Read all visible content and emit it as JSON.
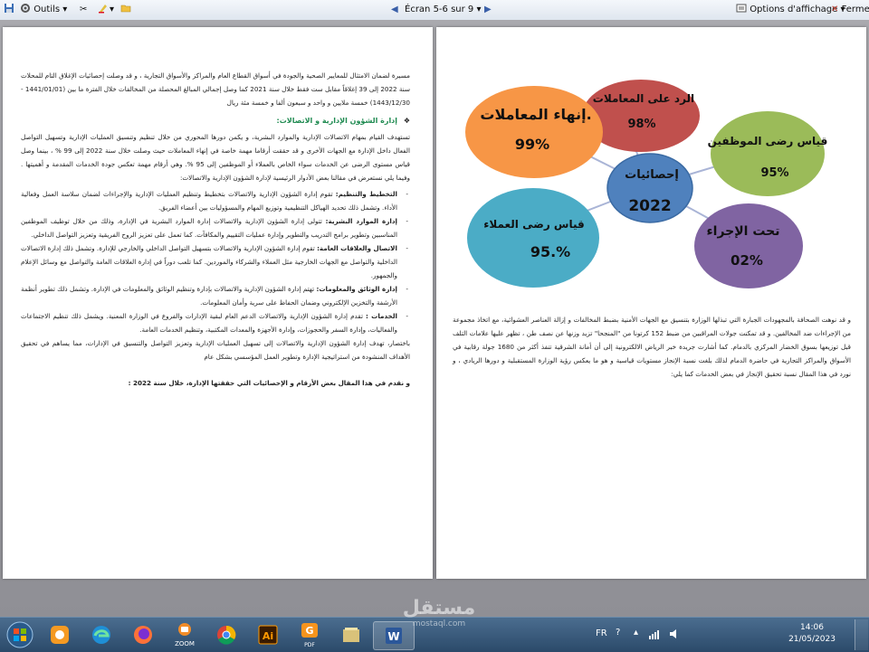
{
  "toolbar": {
    "tools_label": "Outils",
    "screen_label": "Écran 5-6 sur 9",
    "view_options_label": "Options d'affichage",
    "close_label": "Fermer"
  },
  "left_page": {
    "intro": "مسيرة لضمان الامتثال للمعايير الصحية والجودة في أسواق القطاع العام والمراكز والأسواق التجارية ، و قد وصلت إحصائيات الإغلاق التام للمحلات سنة 2022 إلى 39 إغلاقاً مقابل ست فقط خلال سنة 2021 كما وصل إجمالي المبالغ المحصلة من المخالفات خلال الفترة ما بين (1441/01/01 - 1443/12/30) خمسة ملايين و واحد و سبعون ألفا و خمسة مئة ريال",
    "section_heading": "إدارة الشؤون الإدارية و الاتصالات:",
    "section_intro": "تستهدف القيام بمهام الاتصالات الإدارية والموارد البشرية، و يكمن دورها المحوري من خلال تنظيم وتنسيق العمليات الإدارية وتسهيل التواصل الفعال داخل الإدارة مع الجهات الأخرى و قد حققت أرقاما مهمة خاصة في إنهاء المعاملات حيث وصلت خلال سنة 2022 إلى 99 % ، بينما وصل قياس مستوى الرضى عن الخدمات سواء الخاص بالعملاء أو الموظفين إلى 95 %. وهي أرقام مهمة تعكس جودة الخدمات المقدمة و أهميتها . وفيما يلي نستعرض في مقالنا بعض الأدوار الرئيسية لإدارة الشؤون الإدارية والاتصالات:",
    "bullets": [
      {
        "title": "التخطيط والتنظيم:",
        "text": " تقوم إدارة الشؤون الإدارية والاتصالات بتخطيط وتنظيم العمليات الإدارية والإجراءات لضمان سلاسة العمل وفعالية الأداء. وتشمل ذلك تحديد الهياكل التنظيمية وتوزيع المهام والمسؤوليات بين أعضاء الفريق."
      },
      {
        "title": "إدارة الموارد البشرية:",
        "text": " تتولى إدارة الشؤون الإدارية والاتصالات إدارة الموارد البشرية في الإدارة، وذلك من خلال توظيف الموظفين المناسبين وتطوير برامج التدريب والتطوير وإدارة عمليات التقييم والمكافآت. كما تعمل على تعزيز الروح الفريقية وتعزيز التواصل الداخلي."
      },
      {
        "title": "الاتصال والعلاقات العامة:",
        "text": " تقوم إدارة الشؤون الإدارية والاتصالات بتسهيل التواصل الداخلي والخارجي للإدارة. وتشمل ذلك إدارة الاتصالات الداخلية والتواصل مع الجهات الخارجية مثل العملاء والشركاء والموردين. كما تلعب دوراً في إدارة العلاقات العامة والتواصل مع وسائل الإعلام والجمهور."
      },
      {
        "title": "إدارة الوثائق والمعلومات:",
        "text": " تهتم إدارة الشؤون الإدارية والاتصالات بإدارة وتنظيم الوثائق والمعلومات في الإدارة. وتشمل ذلك تطوير أنظمة الأرشفة والتخزين الإلكتروني وضمان الحفاظ على سرية وأمان المعلومات."
      },
      {
        "title": "الخدمات :",
        "text": " تقدم إدارة الشؤون الإدارية والاتصالات الدعم العام لبقية الإدارات والفروع في الوزارة المعنية. ويشمل ذلك تنظيم الاجتماعات والفعاليات، وإدارة السفر والحجوزات، وإدارة الأجهزة والمعدات المكتبية، وتنظيم الخدمات العامة."
      }
    ],
    "summary": "باختصار، تهدف إدارة الشؤون الإدارية والاتصالات إلى تسهيل العمليات الإدارية وتعزيز التواصل والتنسيق في الإدارات، مما يساهم في تحقيق الأهداف المنشودة من استراتيجية الإدارة وتطوير العمل المؤسسي بشكل عام",
    "closing": "و نقدم في هذا المقال بعض الأرقام و الإحصائيات التي حققتها الإدارة، خلال سنة 2022 :"
  },
  "infographic": {
    "center_title": "إحصائيات",
    "center_year": "2022",
    "bubbles": [
      {
        "label": "الرد على المعاملات",
        "value": "98%",
        "color": "#c0504d"
      },
      {
        "label": "إنهاء المعاملات.",
        "value": "99%",
        "color": "#f79646"
      },
      {
        "label": "قياس رضى الموظفين",
        "value": "95%",
        "color": "#9bbb59"
      },
      {
        "label": "قياس رضى العملاء",
        "value": "95.%",
        "color": "#4bacc6"
      },
      {
        "label": "تحت الإجراء",
        "value": "02%",
        "color": "#8064a2"
      }
    ]
  },
  "right_page": {
    "paragraph": "و قد نوهت الصحافة بالمجهودات الجبارة التي تبذلها الوزارة بتنسيق مع الجهات الأمنية بضبط المخالفات و إزالة العناصر العشوائية، مع اتخاذ مجموعة من الإجراءات ضد المخالفين. و قد تمكنت جولات المراقبين من ضبط 152 كرتونا من \"المنجحا\" تزيد وزنها عن نصف طن ، تظهر عليها علامات التلف قبل توزيعها بسوق الخضار المركزي بالدمام. كما أشارت جريدة خبر الرياض الالكترونية إلى أن أمانة الشرقية تنفذ أكثر من 1680 جولة رقابية في الأسواق والمراكز التجارية في حاضرة الدمام لذلك بلغت نسبة الإنجاز مستويات قياسية و هو ما يعكس رؤية الوزارة المستقبلية و دورها الريادي ، و نورد في هذا المقال نسبة تحقيق الإنجاز في بعض الخدمات كما يلي:"
  },
  "taskbar": {
    "lang": "FR",
    "time": "14:06",
    "date": "21/05/2023",
    "zoom_label": "ZOOM",
    "pdf_label": "PDF",
    "watermark": "مستقل",
    "watermark_url": "mostaql.com"
  }
}
